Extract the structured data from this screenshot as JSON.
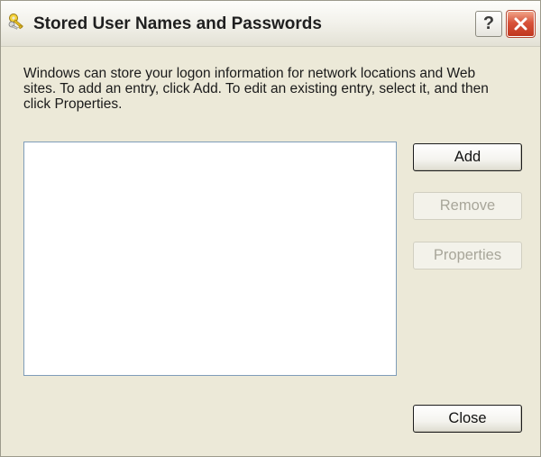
{
  "window": {
    "title": "Stored User Names and Passwords",
    "help_label": "?"
  },
  "description": "Windows can store your logon information for network locations and Web sites. To add an entry, click Add. To edit an existing entry, select it, and then click Properties.",
  "entries": [],
  "buttons": {
    "add": "Add",
    "remove": "Remove",
    "properties": "Properties",
    "close": "Close"
  },
  "icons": {
    "title_icon": "keys-icon",
    "help": "help-icon",
    "close": "close-icon"
  },
  "colors": {
    "window_background": "#ece9d8",
    "close_button": "#d8533a",
    "list_border": "#7f9db9",
    "disabled_text": "#a8a69a"
  }
}
